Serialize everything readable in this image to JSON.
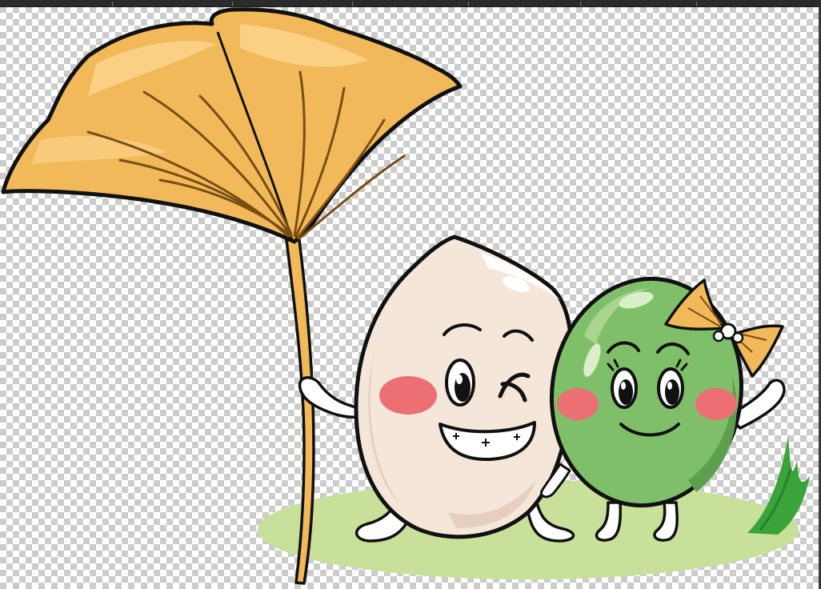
{
  "canvas": {
    "background": "transparency-checkerboard",
    "checker_color": "#cccccc"
  },
  "illustration": {
    "elements": [
      {
        "name": "ginkgo-leaf-umbrella",
        "color": "#f2b95a"
      },
      {
        "name": "ginkgo-nut-character-boy",
        "color": "#f5e6da"
      },
      {
        "name": "green-ginkgo-nut-character-girl",
        "color": "#7fbf6a"
      },
      {
        "name": "ginkgo-bow",
        "color": "#f2b95a"
      },
      {
        "name": "grass-tuft",
        "color": "#3aa33a"
      },
      {
        "name": "ground-patch",
        "color": "#c8e09a"
      }
    ]
  }
}
